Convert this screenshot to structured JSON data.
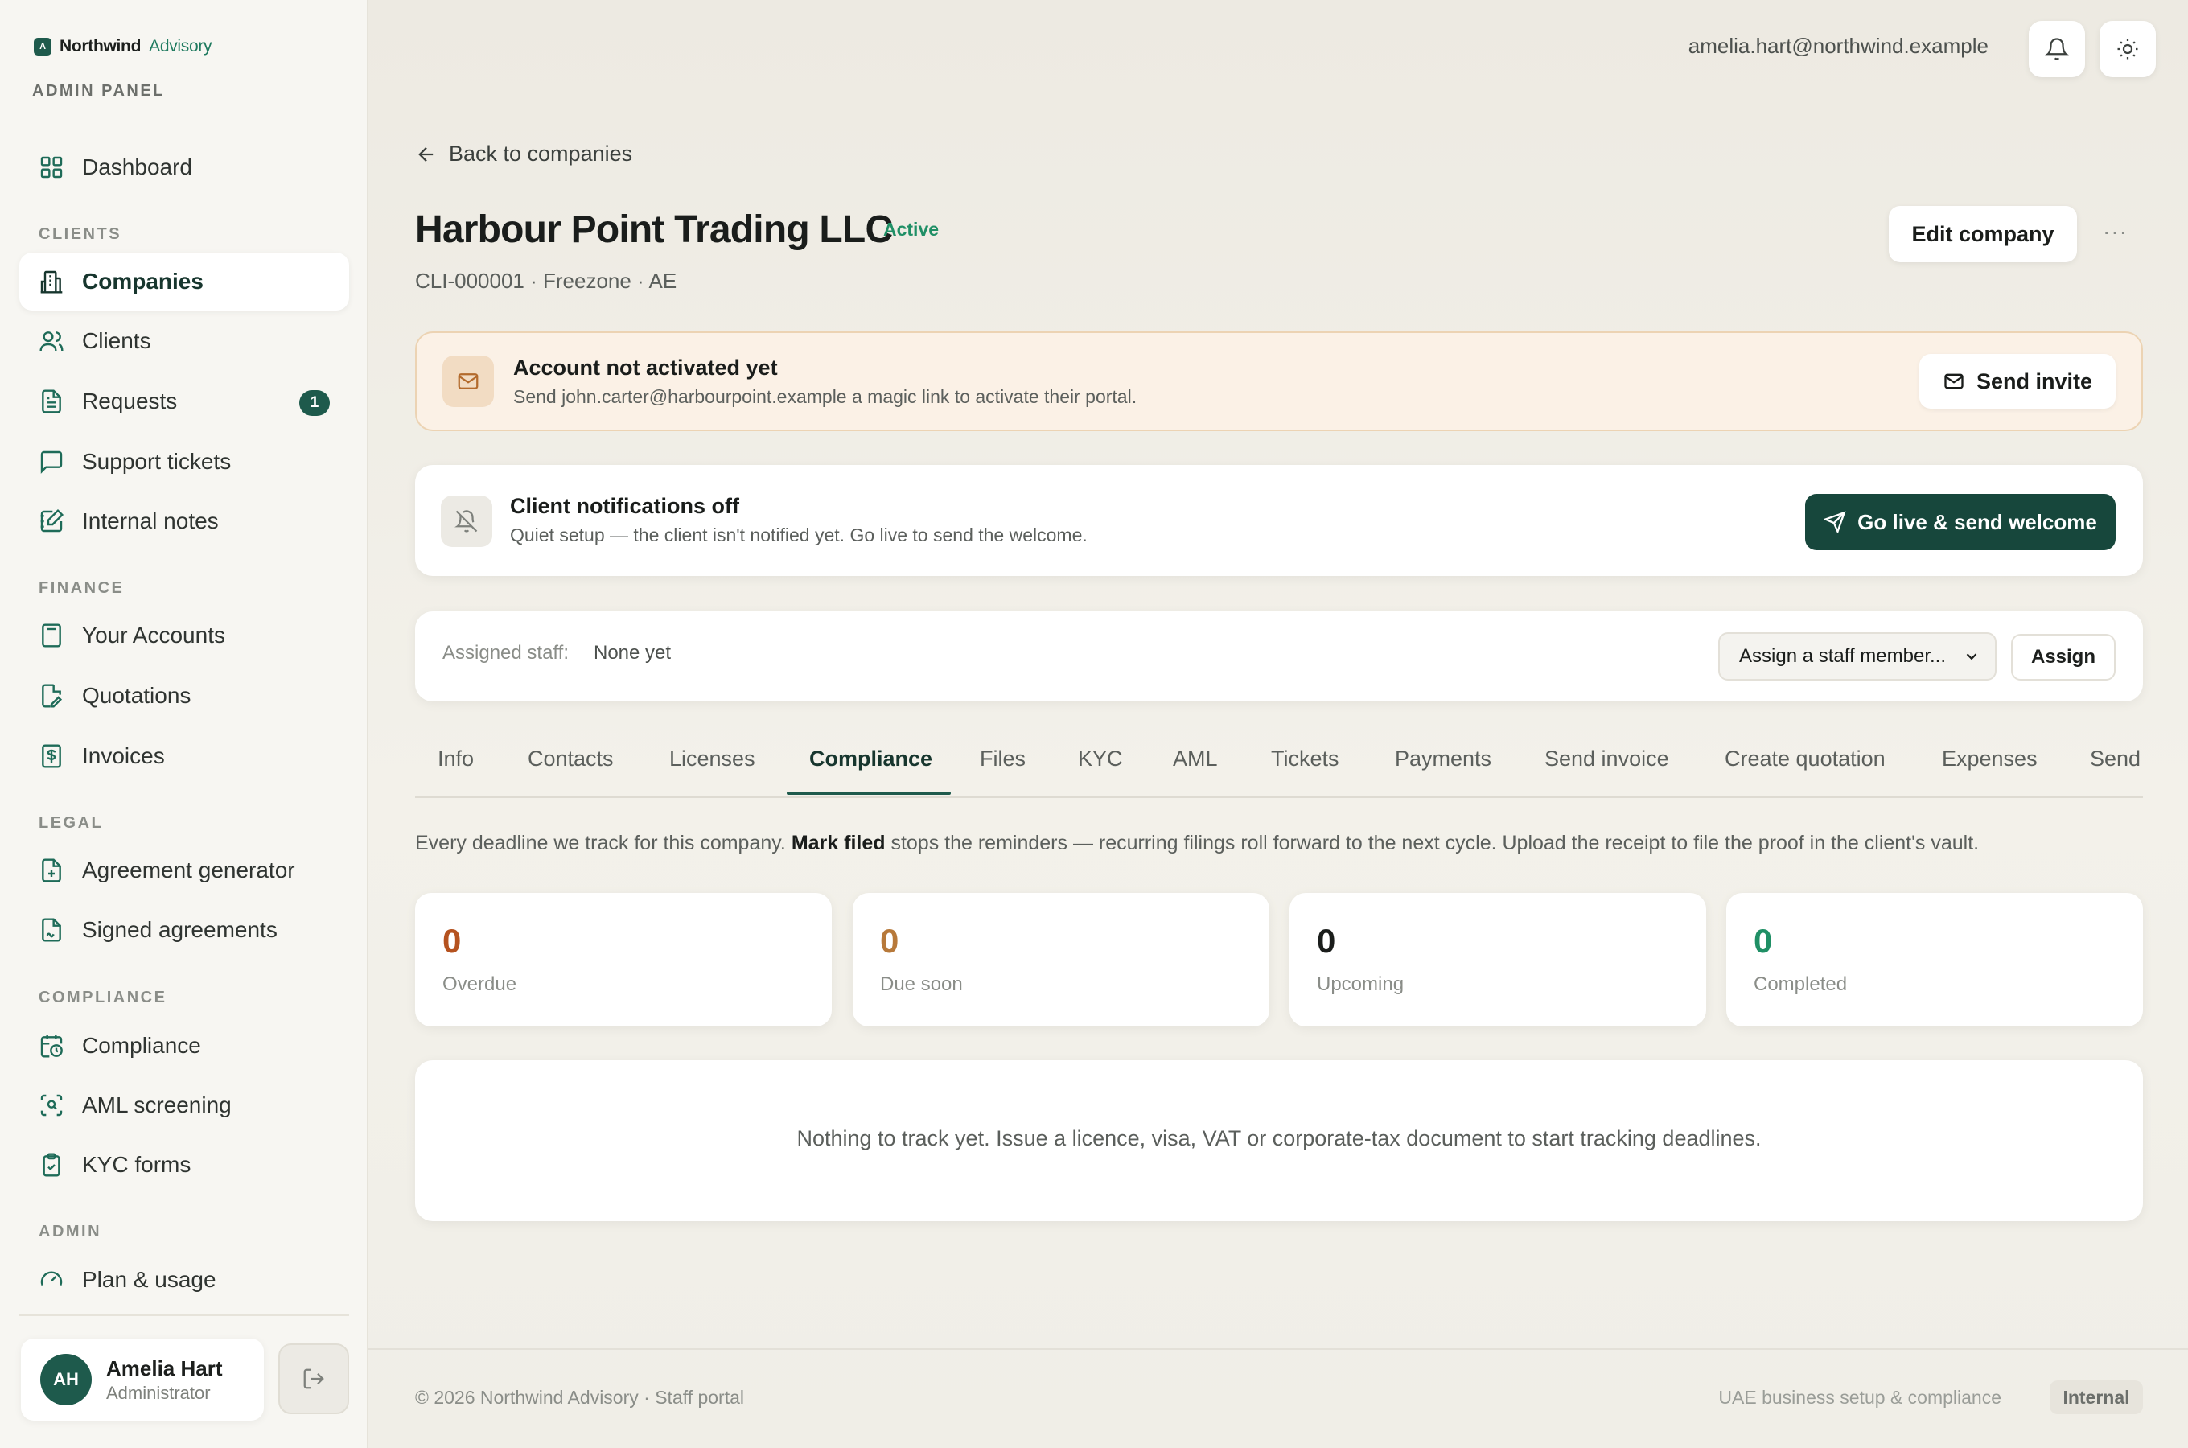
{
  "brand": {
    "name": "Northwind",
    "suffix": "Advisory",
    "logo_letter": "A",
    "panel_label": "ADMIN PANEL"
  },
  "sidebar": {
    "sections": [
      "CLIENTS",
      "FINANCE",
      "LEGAL",
      "COMPLIANCE",
      "ADMIN"
    ],
    "items": [
      {
        "label": "Dashboard",
        "icon": "grid-icon"
      },
      {
        "label": "Companies",
        "icon": "building-icon",
        "active": true
      },
      {
        "label": "Clients",
        "icon": "users-icon"
      },
      {
        "label": "Requests",
        "icon": "document-icon",
        "badge": "1"
      },
      {
        "label": "Support tickets",
        "icon": "chat-icon"
      },
      {
        "label": "Internal notes",
        "icon": "notes-icon"
      },
      {
        "label": "Your Accounts",
        "icon": "calculator-icon"
      },
      {
        "label": "Quotations",
        "icon": "file-edit-icon"
      },
      {
        "label": "Invoices",
        "icon": "dollar-icon"
      },
      {
        "label": "Agreement generator",
        "icon": "file-plus-icon"
      },
      {
        "label": "Signed agreements",
        "icon": "file-sign-icon"
      },
      {
        "label": "Compliance",
        "icon": "calendar-clock-icon"
      },
      {
        "label": "AML screening",
        "icon": "scan-icon"
      },
      {
        "label": "KYC forms",
        "icon": "clipboard-icon"
      },
      {
        "label": "Plan & usage",
        "icon": "gauge-icon"
      }
    ]
  },
  "user": {
    "initials": "AH",
    "name": "Amelia Hart",
    "role": "Administrator"
  },
  "topbar": {
    "email": "amelia.hart@northwind.example"
  },
  "page": {
    "back_label": "Back to companies",
    "title": "Harbour Point Trading LLC",
    "status": "Active",
    "subtitle": "CLI-000001 · Freezone · AE",
    "edit_label": "Edit company",
    "more_label": "···"
  },
  "activation": {
    "title": "Account not activated yet",
    "text": "Send john.carter@harbourpoint.example a magic link to activate their portal.",
    "button": "Send invite"
  },
  "notifications": {
    "title": "Client notifications off",
    "text": "Quiet setup — the client isn't notified yet. Go live to send the welcome.",
    "button": "Go live & send welcome"
  },
  "staff": {
    "label": "Assigned staff:",
    "value": "None yet",
    "select_placeholder": "Assign a staff member...",
    "assign_label": "Assign"
  },
  "tabs": [
    "Info",
    "Contacts",
    "Licenses",
    "Compliance",
    "Files",
    "KYC",
    "AML",
    "Tickets",
    "Payments",
    "Send invoice",
    "Create quotation",
    "Expenses",
    "Send"
  ],
  "active_tab": "Compliance",
  "description": {
    "pre": "Every deadline we track for this company. ",
    "bold": "Mark filed",
    "post": " stops the reminders — recurring filings roll forward to the next cycle. Upload the receipt to file the proof in the client's vault."
  },
  "stats": [
    {
      "value": "0",
      "label": "Overdue",
      "color": "#b5521f"
    },
    {
      "value": "0",
      "label": "Due soon",
      "color": "#b7793a"
    },
    {
      "value": "0",
      "label": "Upcoming",
      "color": "#1a1d1b"
    },
    {
      "value": "0",
      "label": "Completed",
      "color": "#1f8f65"
    }
  ],
  "empty_message": "Nothing to track yet. Issue a licence, visa, VAT or corporate-tax document to start tracking deadlines.",
  "footer": {
    "left": "© 2026 Northwind Advisory · Staff portal",
    "right": "UAE business setup & compliance",
    "badge": "Internal"
  },
  "colors": {
    "accent": "#1e5a4c",
    "accent_dark": "#17473c",
    "warn_bg": "#fbf1e6",
    "warn_border": "#ecd3b3",
    "success": "#1f8f65"
  }
}
